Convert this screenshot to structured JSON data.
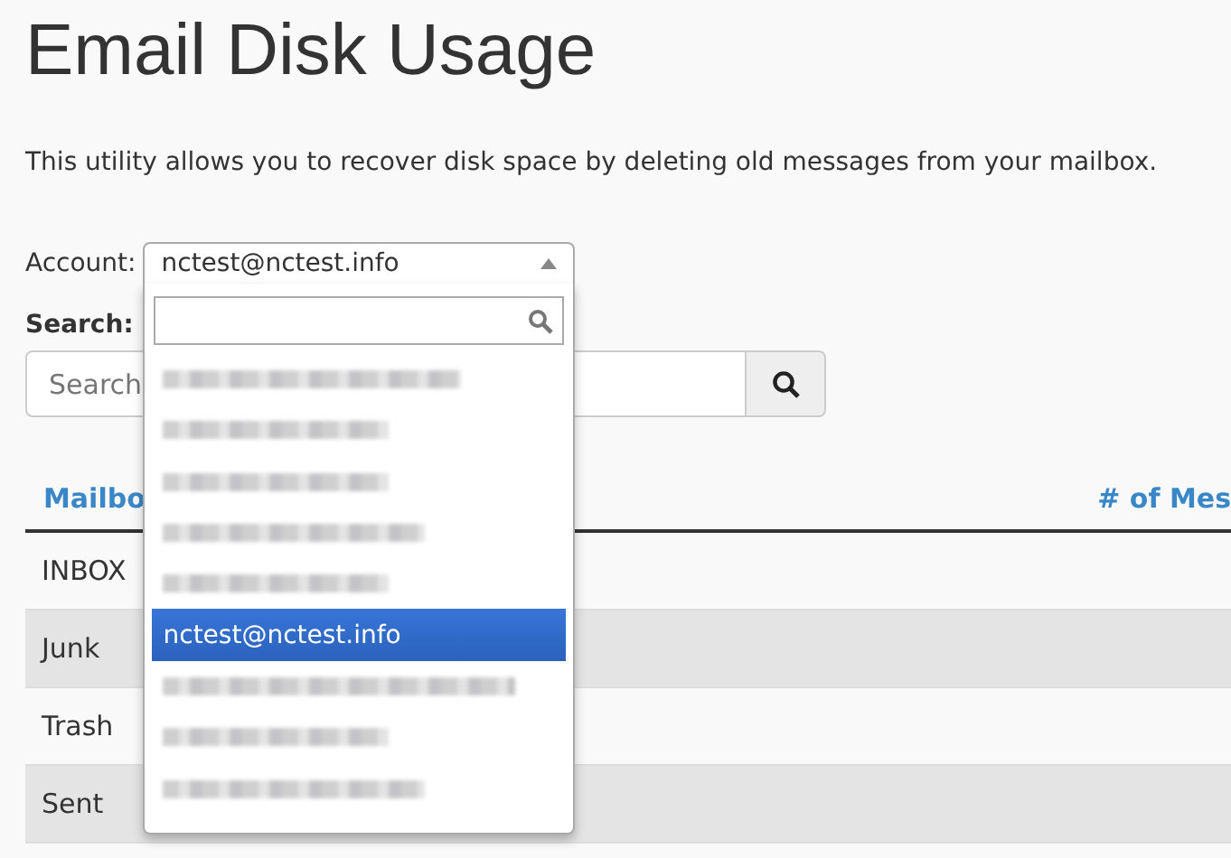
{
  "title": "Email Disk Usage",
  "description": "This utility allows you to recover disk space by deleting old messages from your mailbox.",
  "account": {
    "label": "Account:",
    "value": "nctest@nctest.info",
    "expanded": true,
    "options": [
      {
        "kind": "redacted",
        "selected": false
      },
      {
        "kind": "redacted",
        "selected": false
      },
      {
        "kind": "redacted",
        "selected": false
      },
      {
        "kind": "redacted",
        "selected": false
      },
      {
        "kind": "redacted",
        "selected": false
      },
      {
        "kind": "text",
        "label": "nctest@nctest.info",
        "selected": true
      },
      {
        "kind": "redacted",
        "selected": false
      },
      {
        "kind": "redacted",
        "selected": false
      },
      {
        "kind": "redacted",
        "selected": false
      }
    ]
  },
  "search": {
    "label": "Search:",
    "placeholder": "Search"
  },
  "table": {
    "columns": [
      "Mailbo",
      "# of Mes"
    ],
    "rows": [
      {
        "mailbox": "INBOX"
      },
      {
        "mailbox": "Junk"
      },
      {
        "mailbox": "Trash"
      },
      {
        "mailbox": "Sent"
      }
    ]
  }
}
